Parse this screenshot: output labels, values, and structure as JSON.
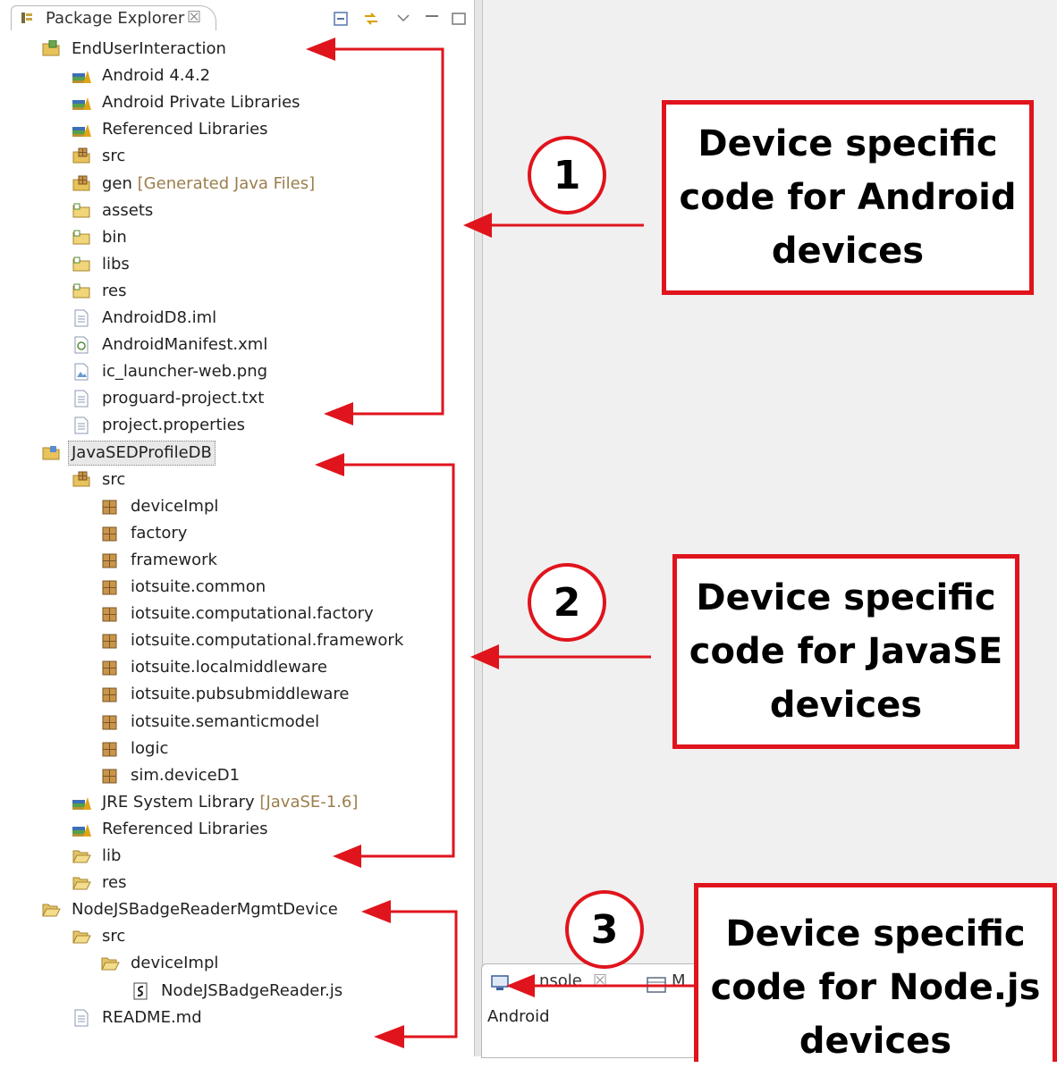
{
  "explorer": {
    "tab_title": "Package Explorer",
    "tab_close": "☒",
    "tree": [
      {
        "label": "EndUserInteraction",
        "suffix": "",
        "icon": "android-project-icon",
        "level": 0
      },
      {
        "label": "Android 4.4.2",
        "suffix": "",
        "icon": "library-icon",
        "level": 1
      },
      {
        "label": "Android Private Libraries",
        "suffix": "",
        "icon": "library-icon",
        "level": 1
      },
      {
        "label": "Referenced Libraries",
        "suffix": "",
        "icon": "library-icon",
        "level": 1
      },
      {
        "label": "src",
        "suffix": "",
        "icon": "source-folder-icon",
        "level": 1
      },
      {
        "label": "gen",
        "suffix": " [Generated Java Files]",
        "icon": "source-folder-icon",
        "level": 1
      },
      {
        "label": "assets",
        "suffix": "",
        "icon": "folder-icon",
        "level": 1
      },
      {
        "label": "bin",
        "suffix": "",
        "icon": "folder-icon",
        "level": 1
      },
      {
        "label": "libs",
        "suffix": "",
        "icon": "folder-icon",
        "level": 1
      },
      {
        "label": "res",
        "suffix": "",
        "icon": "folder-icon",
        "level": 1
      },
      {
        "label": "AndroidD8.iml",
        "suffix": "",
        "icon": "file-icon",
        "level": 1
      },
      {
        "label": "AndroidManifest.xml",
        "suffix": "",
        "icon": "android-manifest-icon",
        "level": 1
      },
      {
        "label": "ic_launcher-web.png",
        "suffix": "",
        "icon": "image-file-icon",
        "level": 1
      },
      {
        "label": "proguard-project.txt",
        "suffix": "",
        "icon": "file-icon",
        "level": 1
      },
      {
        "label": "project.properties",
        "suffix": "",
        "icon": "file-icon",
        "level": 1
      },
      {
        "label": "JavaSEDProfileDB",
        "suffix": "",
        "icon": "java-project-icon",
        "level": 0,
        "selected": true
      },
      {
        "label": "src",
        "suffix": "",
        "icon": "source-folder-icon",
        "level": 1
      },
      {
        "label": "deviceImpl",
        "suffix": "",
        "icon": "package-icon",
        "level": 2
      },
      {
        "label": "factory",
        "suffix": "",
        "icon": "package-icon",
        "level": 2
      },
      {
        "label": "framework",
        "suffix": "",
        "icon": "package-icon",
        "level": 2
      },
      {
        "label": "iotsuite.common",
        "suffix": "",
        "icon": "package-icon",
        "level": 2
      },
      {
        "label": "iotsuite.computational.factory",
        "suffix": "",
        "icon": "package-icon",
        "level": 2
      },
      {
        "label": "iotsuite.computational.framework",
        "suffix": "",
        "icon": "package-icon",
        "level": 2
      },
      {
        "label": "iotsuite.localmiddleware",
        "suffix": "",
        "icon": "package-icon",
        "level": 2
      },
      {
        "label": "iotsuite.pubsubmiddleware",
        "suffix": "",
        "icon": "package-icon",
        "level": 2
      },
      {
        "label": "iotsuite.semanticmodel",
        "suffix": "",
        "icon": "package-icon",
        "level": 2
      },
      {
        "label": "logic",
        "suffix": "",
        "icon": "package-icon",
        "level": 2
      },
      {
        "label": "sim.deviceD1",
        "suffix": "",
        "icon": "package-icon",
        "level": 2
      },
      {
        "label": "JRE System Library",
        "suffix": " [JavaSE-1.6]",
        "icon": "library-icon",
        "level": 1
      },
      {
        "label": "Referenced Libraries",
        "suffix": "",
        "icon": "library-icon",
        "level": 1
      },
      {
        "label": "lib",
        "suffix": "",
        "icon": "open-folder-icon",
        "level": 1
      },
      {
        "label": "res",
        "suffix": "",
        "icon": "open-folder-icon",
        "level": 1
      },
      {
        "label": "NodeJSBadgeReaderMgmtDevice",
        "suffix": "",
        "icon": "open-folder-icon",
        "level": 0
      },
      {
        "label": "src",
        "suffix": "",
        "icon": "open-folder-icon",
        "level": 1
      },
      {
        "label": "deviceImpl",
        "suffix": "",
        "icon": "open-folder-icon",
        "level": 2
      },
      {
        "label": "NodeJSBadgeReader.js",
        "suffix": "",
        "icon": "script-file-icon",
        "level": 3
      },
      {
        "label": "README.md",
        "suffix": "",
        "icon": "file-icon",
        "level": 1
      }
    ]
  },
  "bottom_panel": {
    "console_tab": "nsole",
    "console_close": "☒",
    "second_tab": "M",
    "console_text": "Android"
  },
  "annotations": {
    "callout1": {
      "number": "1",
      "lines": [
        "Device specific",
        "code for Android",
        "devices"
      ]
    },
    "callout2": {
      "number": "2",
      "lines": [
        "Device specific",
        "code for JavaSE",
        "devices"
      ]
    },
    "callout3": {
      "number": "3",
      "lines": [
        "Device specific",
        "code for Node.js",
        "devices"
      ]
    },
    "accent_color": "#e0141c"
  }
}
